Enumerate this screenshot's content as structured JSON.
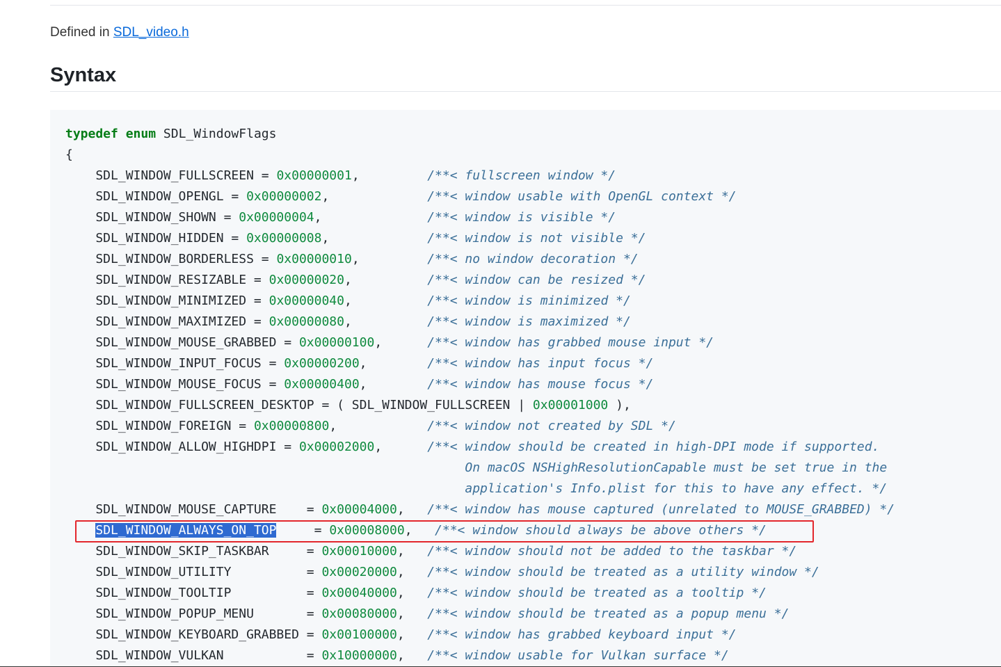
{
  "defined_in": {
    "prefix": "Defined in ",
    "link_text": "SDL_video.h"
  },
  "syntax_title": "Syntax",
  "code": {
    "line0": {
      "kw1": "typedef",
      "sp": " ",
      "kw2": "enum",
      "rest": " SDL_WindowFlags"
    },
    "brace_open": "{",
    "lines": [
      {
        "pre": "    SDL_WINDOW_FULLSCREEN = ",
        "num": "0x00000001",
        "mid": ",         ",
        "cm": "/**< fullscreen window */"
      },
      {
        "pre": "    SDL_WINDOW_OPENGL = ",
        "num": "0x00000002",
        "mid": ",             ",
        "cm": "/**< window usable with OpenGL context */"
      },
      {
        "pre": "    SDL_WINDOW_SHOWN = ",
        "num": "0x00000004",
        "mid": ",              ",
        "cm": "/**< window is visible */"
      },
      {
        "pre": "    SDL_WINDOW_HIDDEN = ",
        "num": "0x00000008",
        "mid": ",             ",
        "cm": "/**< window is not visible */"
      },
      {
        "pre": "    SDL_WINDOW_BORDERLESS = ",
        "num": "0x00000010",
        "mid": ",         ",
        "cm": "/**< no window decoration */"
      },
      {
        "pre": "    SDL_WINDOW_RESIZABLE = ",
        "num": "0x00000020",
        "mid": ",          ",
        "cm": "/**< window can be resized */"
      },
      {
        "pre": "    SDL_WINDOW_MINIMIZED = ",
        "num": "0x00000040",
        "mid": ",          ",
        "cm": "/**< window is minimized */"
      },
      {
        "pre": "    SDL_WINDOW_MAXIMIZED = ",
        "num": "0x00000080",
        "mid": ",          ",
        "cm": "/**< window is maximized */"
      },
      {
        "pre": "    SDL_WINDOW_MOUSE_GRABBED = ",
        "num": "0x00000100",
        "mid": ",      ",
        "cm": "/**< window has grabbed mouse input */"
      },
      {
        "pre": "    SDL_WINDOW_INPUT_FOCUS = ",
        "num": "0x00000200",
        "mid": ",        ",
        "cm": "/**< window has input focus */"
      },
      {
        "pre": "    SDL_WINDOW_MOUSE_FOCUS = ",
        "num": "0x00000400",
        "mid": ",        ",
        "cm": "/**< window has mouse focus */"
      },
      {
        "pre": "    SDL_WINDOW_FULLSCREEN_DESKTOP = ( SDL_WINDOW_FULLSCREEN | ",
        "num": "0x00001000",
        "mid": " ),",
        "cm": ""
      },
      {
        "pre": "    SDL_WINDOW_FOREIGN = ",
        "num": "0x00000800",
        "mid": ",            ",
        "cm": "/**< window not created by SDL */"
      },
      {
        "pre": "    SDL_WINDOW_ALLOW_HIGHDPI = ",
        "num": "0x00002000",
        "mid": ",      ",
        "cm": "/**< window should be created in high-DPI mode if supported."
      },
      {
        "pre": "",
        "num": "",
        "mid": "",
        "cm": "                                                     On macOS NSHighResolutionCapable must be set true in the"
      },
      {
        "pre": "",
        "num": "",
        "mid": "",
        "cm": "                                                     application's Info.plist for this to have any effect. */"
      },
      {
        "pre": "    SDL_WINDOW_MOUSE_CAPTURE    = ",
        "num": "0x00004000",
        "mid": ",   ",
        "cm": "/**< window has mouse captured (unrelated to MOUSE_GRABBED) */"
      },
      {
        "sel": "SDL_WINDOW_ALWAYS_ON_TOP",
        "pre": "     = ",
        "num": "0x00008000",
        "mid": ",   ",
        "cm": "/**< window should always be above others */"
      },
      {
        "pre": "    SDL_WINDOW_SKIP_TASKBAR     = ",
        "num": "0x00010000",
        "mid": ",   ",
        "cm": "/**< window should not be added to the taskbar */"
      },
      {
        "pre": "    SDL_WINDOW_UTILITY          = ",
        "num": "0x00020000",
        "mid": ",   ",
        "cm": "/**< window should be treated as a utility window */"
      },
      {
        "pre": "    SDL_WINDOW_TOOLTIP          = ",
        "num": "0x00040000",
        "mid": ",   ",
        "cm": "/**< window should be treated as a tooltip */"
      },
      {
        "pre": "    SDL_WINDOW_POPUP_MENU       = ",
        "num": "0x00080000",
        "mid": ",   ",
        "cm": "/**< window should be treated as a popup menu */"
      },
      {
        "pre": "    SDL_WINDOW_KEYBOARD_GRABBED = ",
        "num": "0x00100000",
        "mid": ",   ",
        "cm": "/**< window has grabbed keyboard input */"
      },
      {
        "pre": "    SDL_WINDOW_VULKAN           = ",
        "num": "0x10000000",
        "mid": ",   ",
        "cm": "/**< window usable for Vulkan surface */"
      }
    ]
  },
  "colors": {
    "keyword": "#067d17",
    "number": "#0f8a3e",
    "comment": "#3b6f98",
    "selection": "#2f6ad1",
    "annotation": "#e3272c",
    "link": "#0969da"
  }
}
